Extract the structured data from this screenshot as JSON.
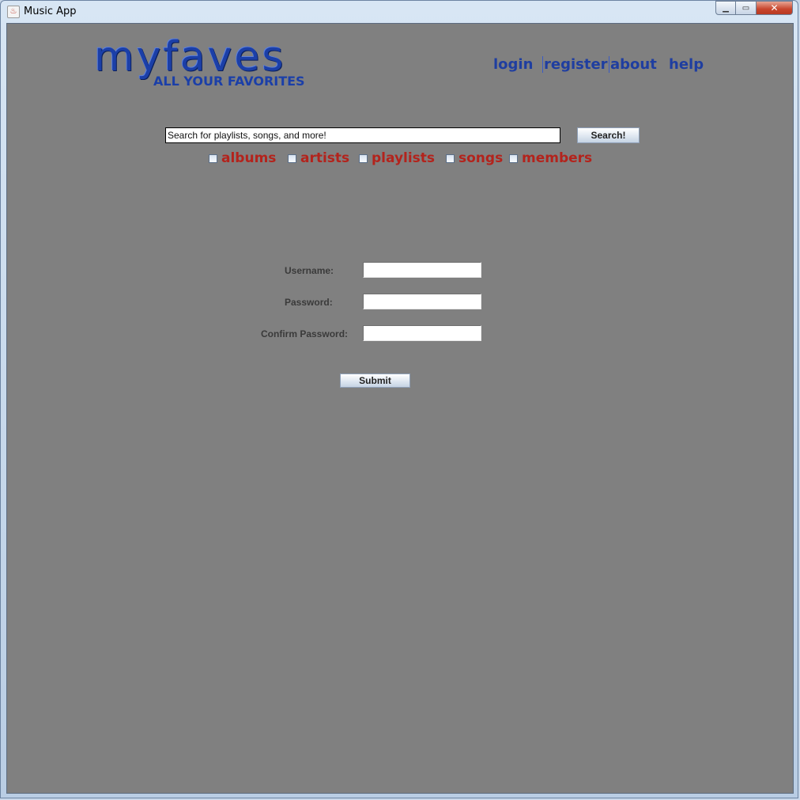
{
  "window": {
    "title": "Music App",
    "app_icon": "java-cup-icon"
  },
  "logo": {
    "main": "myfaves",
    "tagline": "ALL YOUR FAVORITES"
  },
  "nav": {
    "login": "login",
    "register": "register",
    "about": "about",
    "help": "help"
  },
  "search": {
    "value": "Search for playlists, songs, and more!",
    "button": "Search!"
  },
  "filters": {
    "albums": "albums",
    "artists": "artists",
    "playlists": "playlists",
    "songs": "songs",
    "members": "members"
  },
  "form": {
    "username_label": "Username:",
    "password_label": "Password:",
    "confirm_label": "Confirm Password:",
    "submit": "Submit"
  },
  "colors": {
    "background": "#808080",
    "nav": "#1f3ea0",
    "filter_label": "#b3231c",
    "logo": "#1b3fa8"
  }
}
